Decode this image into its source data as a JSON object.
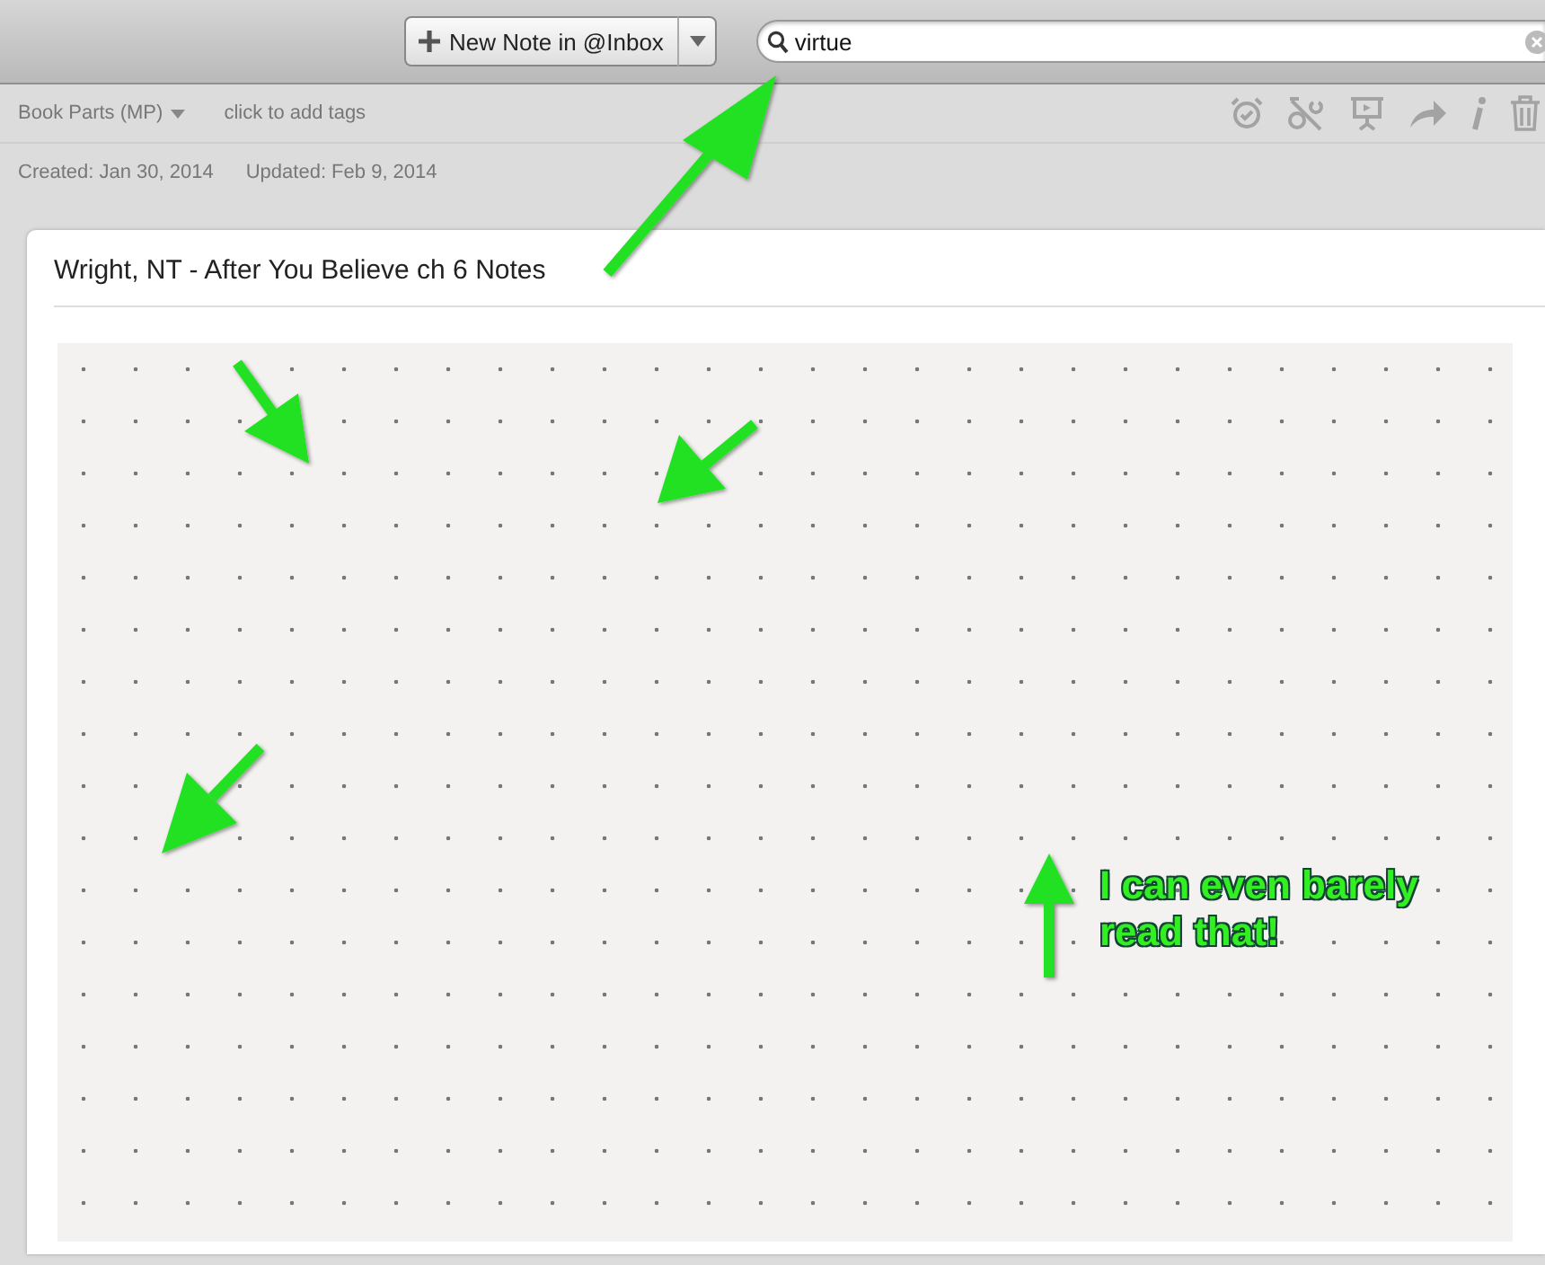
{
  "toolbar": {
    "new_note_button": "New Note in @Inbox",
    "search": {
      "value": "virtue"
    }
  },
  "note_header": {
    "notebook": "Book Parts (MP)",
    "tags_placeholder": "click to add tags",
    "created": "Created: Jan 30, 2014",
    "updated": "Updated: Feb 9, 2014"
  },
  "note": {
    "title": "Wright, NT - After You Believe ch 6 Notes"
  },
  "annotation": {
    "text": "I can even barely read that!"
  }
}
